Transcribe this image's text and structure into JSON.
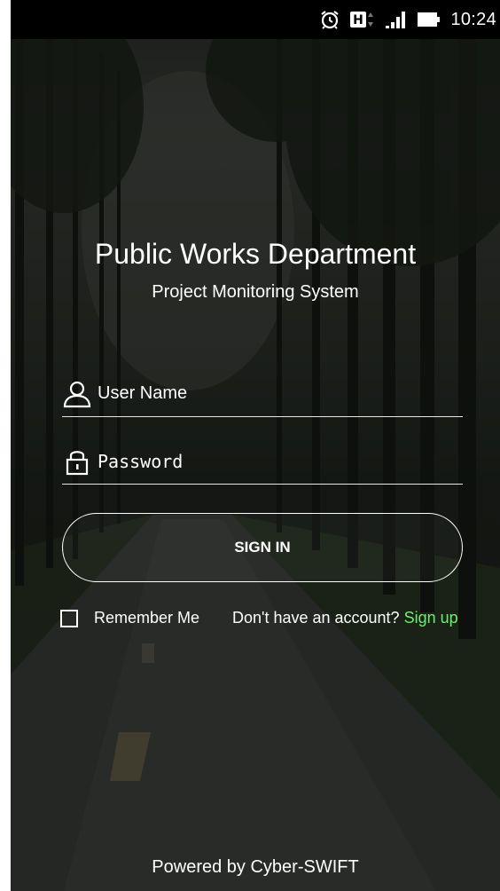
{
  "status_bar": {
    "time": "10:24",
    "icons": [
      "alarm-icon",
      "h-network-icon",
      "signal-icon",
      "battery-icon"
    ],
    "network_label": "H"
  },
  "header": {
    "title": "Public Works Department",
    "subtitle": "Project Monitoring System"
  },
  "form": {
    "username_placeholder": "User Name",
    "password_placeholder": "Password",
    "username_icon": "user-icon",
    "password_icon": "lock-icon",
    "signin_label": "SIGN IN",
    "remember_label": "Remember Me",
    "remember_checked": false,
    "account_prompt": "Don't have an account?",
    "signup_label": "Sign up"
  },
  "footer": {
    "powered_by": "Powered by Cyber-SWIFT"
  },
  "colors": {
    "signup_link": "#6df06d",
    "text": "#ffffff",
    "status_bar_bg": "#000000"
  }
}
